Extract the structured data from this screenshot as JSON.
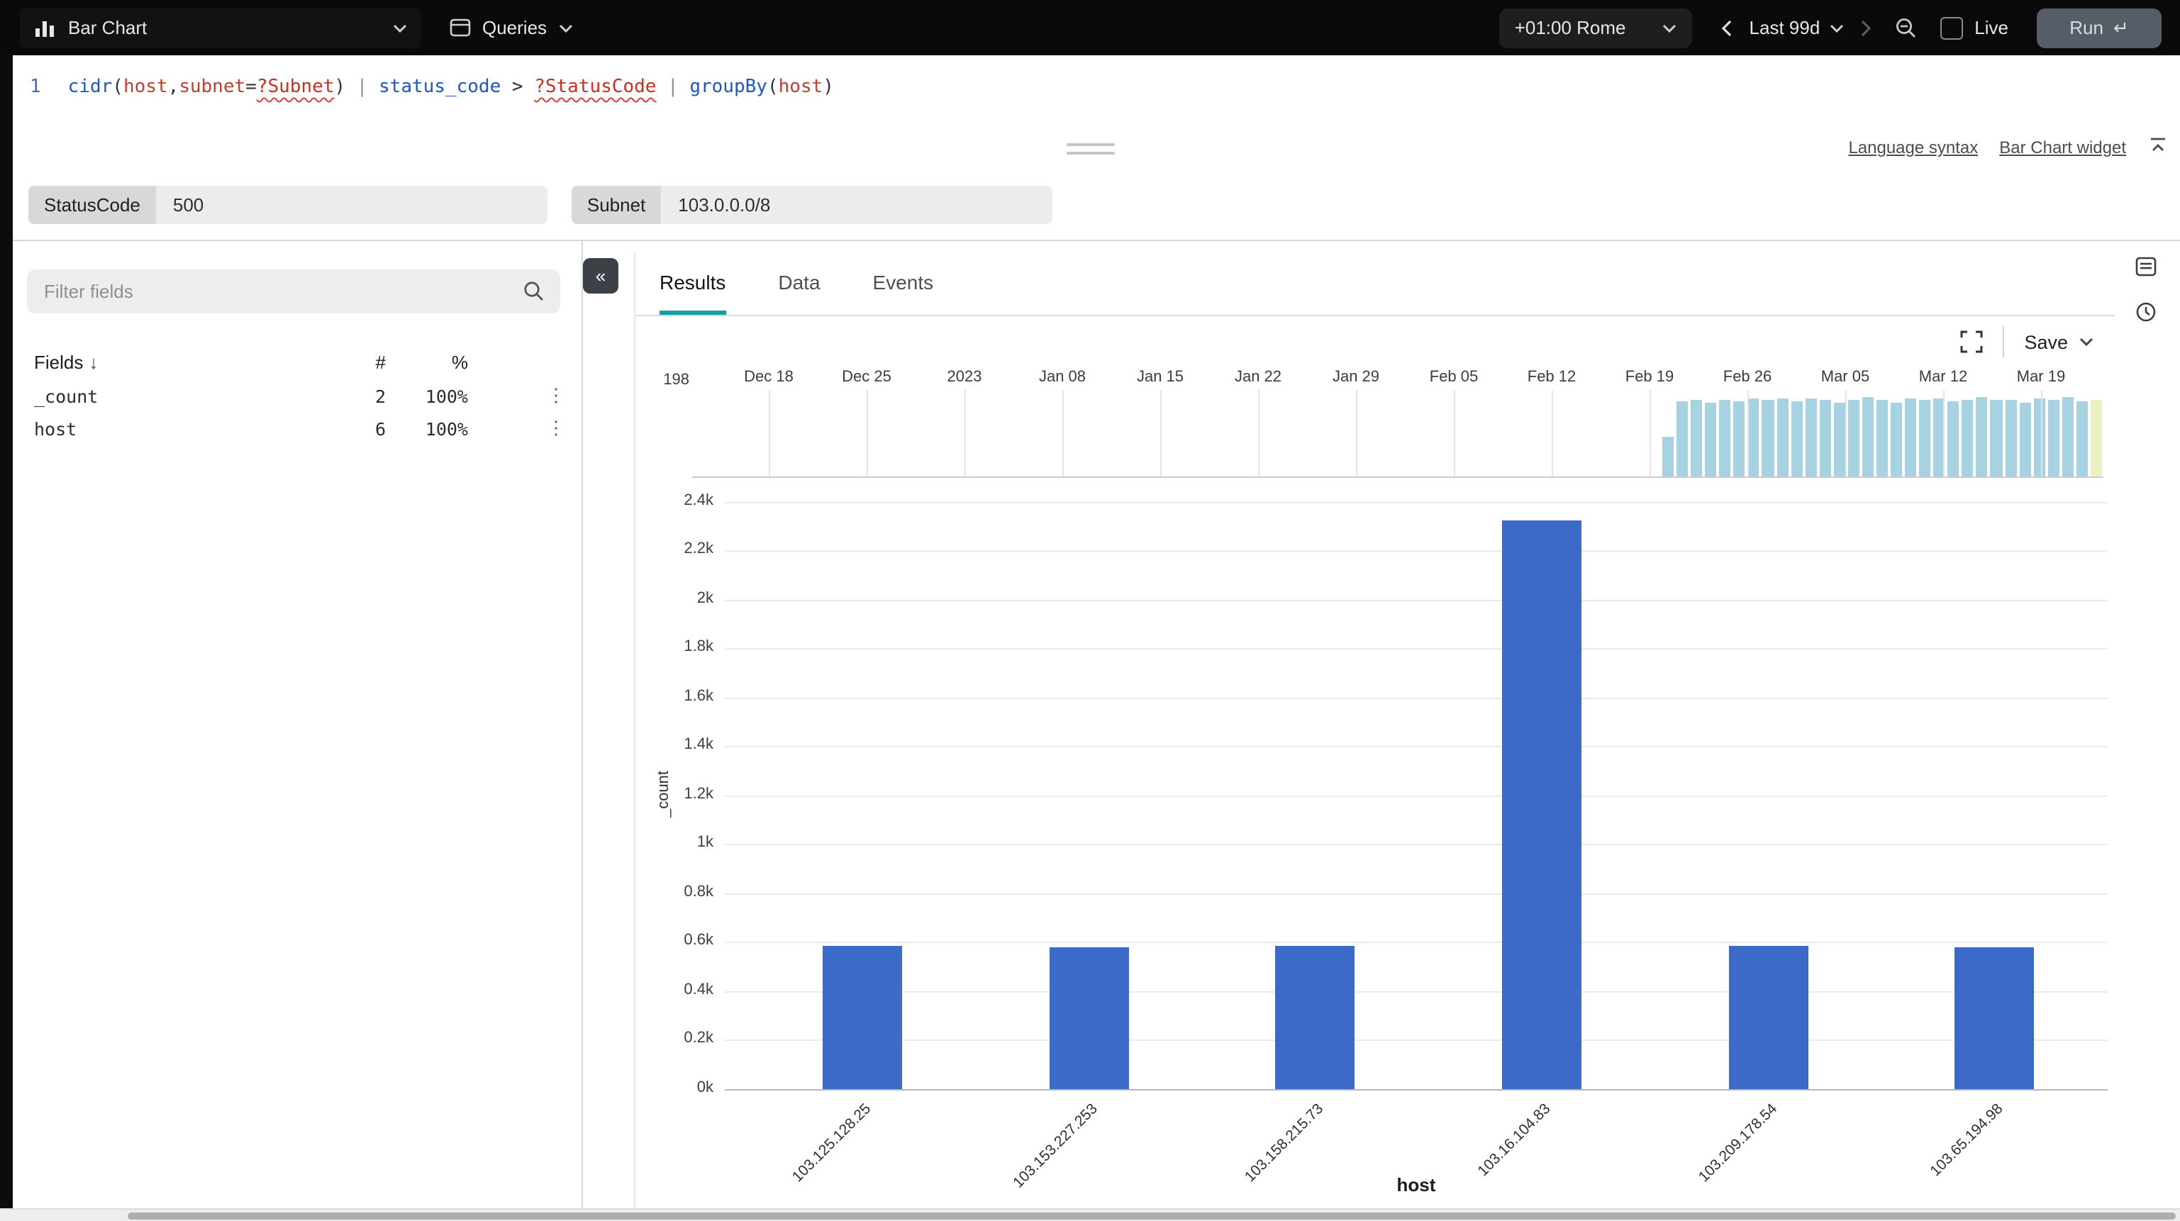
{
  "topbar": {
    "view_select": "Bar Chart",
    "queries_label": "Queries",
    "timezone": "+01:00 Rome",
    "time_range": "Last 99d",
    "live_label": "Live",
    "run_label": "Run",
    "run_key": "↵"
  },
  "editor": {
    "line_number": "1",
    "query_tokens": [
      {
        "text": "cidr",
        "type": "function"
      },
      {
        "text": "(",
        "type": "plain"
      },
      {
        "text": "host",
        "type": "field"
      },
      {
        "text": ",",
        "type": "plain"
      },
      {
        "text": "subnet",
        "type": "field"
      },
      {
        "text": "=",
        "type": "plain"
      },
      {
        "text": "?Subnet",
        "type": "parameter"
      },
      {
        "text": ")",
        "type": "plain"
      },
      {
        "text": " | ",
        "type": "pipe"
      },
      {
        "text": "status_code",
        "type": "function"
      },
      {
        "text": " > ",
        "type": "plain"
      },
      {
        "text": "?StatusCode",
        "type": "parameter"
      },
      {
        "text": " | ",
        "type": "pipe"
      },
      {
        "text": "groupBy",
        "type": "function"
      },
      {
        "text": "(",
        "type": "plain"
      },
      {
        "text": "host",
        "type": "field"
      },
      {
        "text": ")",
        "type": "plain"
      }
    ],
    "links": {
      "language_syntax": "Language syntax",
      "widget_docs": "Bar Chart widget"
    }
  },
  "parameters": [
    {
      "name": "StatusCode",
      "value": "500"
    },
    {
      "name": "Subnet",
      "value": "103.0.0.0/8"
    }
  ],
  "fields_panel": {
    "filter_placeholder": "Filter fields",
    "columns": {
      "name": "Fields",
      "count": "#",
      "percent": "%"
    },
    "sort_icon": "↓",
    "kebab_icon": "⋮",
    "collapse_icon": "«",
    "rows": [
      {
        "name": "_count",
        "count": "2",
        "percent": "100%"
      },
      {
        "name": "host",
        "count": "6",
        "percent": "100%"
      }
    ]
  },
  "results": {
    "tabs": [
      "Results",
      "Data",
      "Events"
    ],
    "active_tab": "Results",
    "save_label": "Save"
  },
  "chart_data": [
    {
      "id": "event-timeline",
      "type": "bar",
      "y_max_label": "198",
      "ymax": 198,
      "x_ticks": [
        "Dec 18",
        "Dec 25",
        "2023",
        "Jan 08",
        "Jan 15",
        "Jan 22",
        "Jan 29",
        "Feb 05",
        "Feb 12",
        "Feb 19",
        "Feb 26",
        "Mar 05",
        "Mar 12",
        "Mar 19"
      ],
      "values": [
        88,
        168,
        172,
        166,
        174,
        170,
        177,
        172,
        175,
        169,
        177,
        173,
        167,
        174,
        179,
        172,
        166,
        175,
        171,
        177,
        168,
        173,
        179,
        171,
        174,
        167,
        176,
        172,
        178,
        170,
        172
      ],
      "bar_color": "#a6d2e1",
      "last_bar_color": "#edf0c5"
    },
    {
      "id": "groupby-host",
      "type": "bar",
      "categories": [
        "103.125.128.25",
        "103.153.227.253",
        "103.158.215.73",
        "103.16.104.83",
        "103.209.178.54",
        "103.65.194.98"
      ],
      "values": [
        585,
        580,
        585,
        2325,
        585,
        580
      ],
      "xlabel": "host",
      "ylabel": "_count",
      "ylim": [
        0,
        2400
      ],
      "y_ticks": [
        "0k",
        "0.2k",
        "0.4k",
        "0.6k",
        "0.8k",
        "1k",
        "1.2k",
        "1.4k",
        "1.6k",
        "1.8k",
        "2k",
        "2.2k",
        "2.4k"
      ],
      "bar_color": "#3b6ac8",
      "grid": true,
      "legend": false
    }
  ],
  "colors": {
    "accent_teal": "#12a0a5",
    "bar_blue": "#3b6ac8",
    "timeline_blue": "#a6d2e1",
    "timeline_highlight": "#edf0c5"
  }
}
